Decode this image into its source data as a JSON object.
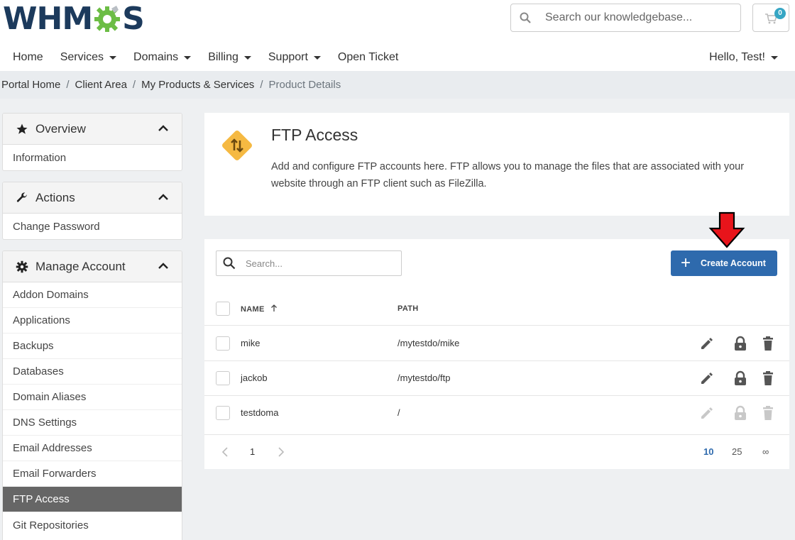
{
  "header": {
    "logo_text_left": "WHM",
    "logo_text_right": "S",
    "search_placeholder": "Search our knowledgebase...",
    "cart_count": "0"
  },
  "nav": {
    "items": [
      {
        "label": "Home",
        "dropdown": false
      },
      {
        "label": "Services",
        "dropdown": true
      },
      {
        "label": "Domains",
        "dropdown": true
      },
      {
        "label": "Billing",
        "dropdown": true
      },
      {
        "label": "Support",
        "dropdown": true
      },
      {
        "label": "Open Ticket",
        "dropdown": false
      }
    ],
    "user_label": "Hello, Test!"
  },
  "breadcrumb": [
    "Portal Home",
    "Client Area",
    "My Products & Services",
    "Product Details"
  ],
  "sidebar": {
    "overview": {
      "title": "Overview",
      "items": [
        "Information"
      ]
    },
    "actions": {
      "title": "Actions",
      "items": [
        "Change Password"
      ]
    },
    "manage": {
      "title": "Manage Account",
      "items": [
        "Addon Domains",
        "Applications",
        "Backups",
        "Databases",
        "Domain Aliases",
        "DNS Settings",
        "Email Addresses",
        "Email Forwarders",
        "FTP Access",
        "Git Repositories"
      ],
      "active": "FTP Access"
    }
  },
  "intro": {
    "title": "FTP Access",
    "description": "Add and configure FTP accounts here. FTP allows you to manage the files that are associated with your website through an FTP client such as FileZilla."
  },
  "table": {
    "search_placeholder": "Search...",
    "create_button": "Create Account",
    "columns": [
      "NAME",
      "PATH"
    ],
    "rows": [
      {
        "name": "mike",
        "path": "/mytestdo/mike",
        "actions_enabled": true
      },
      {
        "name": "jackob",
        "path": "/mytestdo/ftp",
        "actions_enabled": true
      },
      {
        "name": "testdoma",
        "path": "/",
        "actions_enabled": false
      }
    ],
    "pagination": {
      "page": "1",
      "sizes": [
        "10",
        "25",
        "∞"
      ],
      "active_size": "10"
    }
  },
  "colors": {
    "primary": "#2e6aad",
    "logo_dark": "#1c3a5c",
    "logo_green": "#6cbd45",
    "intro_icon": "#f5b942",
    "arrow": "#e8141b"
  }
}
